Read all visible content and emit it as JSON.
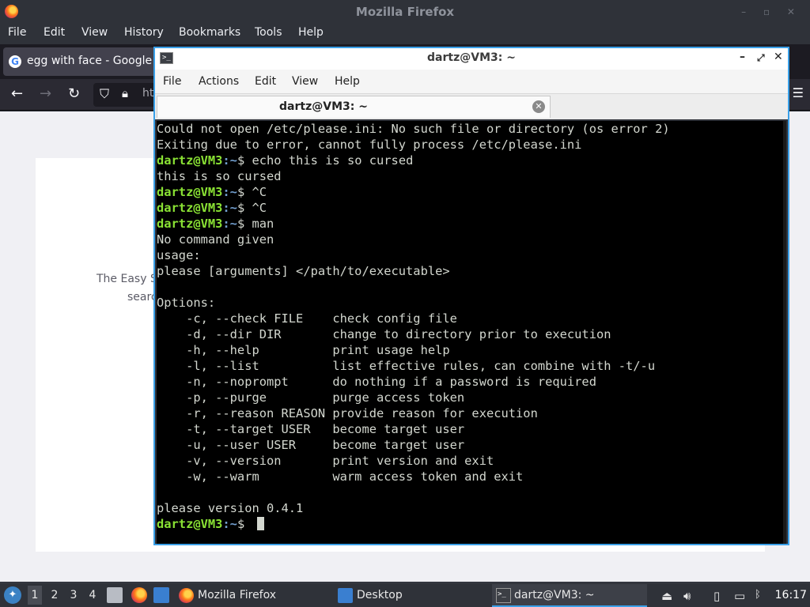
{
  "firefox": {
    "window_title": "Mozilla Firefox",
    "menu": [
      "File",
      "Edit",
      "View",
      "History",
      "Bookmarks",
      "Tools",
      "Help"
    ],
    "tab_title": "egg with face - Google S",
    "url_partial": "ht",
    "page_text_line1": "The Easy S",
    "page_text_line2": "searc"
  },
  "terminal": {
    "window_title": "dartz@VM3: ~",
    "menu": [
      "File",
      "Actions",
      "Edit",
      "View",
      "Help"
    ],
    "tab_title": "dartz@VM3: ~",
    "prompt_user": "dartz@VM3",
    "prompt_path": ":~",
    "prompt_symbol": "$ ",
    "lines": [
      {
        "type": "out",
        "text": "Could not open /etc/please.ini: No such file or directory (os error 2)"
      },
      {
        "type": "out",
        "text": "Exiting due to error, cannot fully process /etc/please.ini"
      },
      {
        "type": "cmd",
        "text": "echo this is so cursed"
      },
      {
        "type": "out",
        "text": "this is so cursed"
      },
      {
        "type": "cmd",
        "text": "^C"
      },
      {
        "type": "cmd",
        "text": "^C"
      },
      {
        "type": "cmd",
        "text": "man"
      },
      {
        "type": "out",
        "text": "No command given"
      },
      {
        "type": "out",
        "text": "usage:"
      },
      {
        "type": "out",
        "text": "please [arguments] </path/to/executable>"
      },
      {
        "type": "out",
        "text": ""
      },
      {
        "type": "out",
        "text": "Options:"
      },
      {
        "type": "out",
        "text": "    -c, --check FILE    check config file"
      },
      {
        "type": "out",
        "text": "    -d, --dir DIR       change to directory prior to execution"
      },
      {
        "type": "out",
        "text": "    -h, --help          print usage help"
      },
      {
        "type": "out",
        "text": "    -l, --list          list effective rules, can combine with -t/-u"
      },
      {
        "type": "out",
        "text": "    -n, --noprompt      do nothing if a password is required"
      },
      {
        "type": "out",
        "text": "    -p, --purge         purge access token"
      },
      {
        "type": "out",
        "text": "    -r, --reason REASON provide reason for execution"
      },
      {
        "type": "out",
        "text": "    -t, --target USER   become target user"
      },
      {
        "type": "out",
        "text": "    -u, --user USER     become target user"
      },
      {
        "type": "out",
        "text": "    -v, --version       print version and exit"
      },
      {
        "type": "out",
        "text": "    -w, --warm          warm access token and exit"
      },
      {
        "type": "out",
        "text": ""
      },
      {
        "type": "out",
        "text": "please version 0.4.1"
      },
      {
        "type": "cursor",
        "text": ""
      }
    ]
  },
  "taskbar": {
    "workspaces": [
      "1",
      "2",
      "3",
      "4"
    ],
    "active_workspace": "1",
    "tasks": [
      "Mozilla Firefox",
      "Desktop",
      "dartz@VM3: ~"
    ],
    "clock": "16:17"
  },
  "colors": {
    "accent": "#3aa0e8",
    "prompt_user": "#8ae234",
    "prompt_path": "#729fcf",
    "terminal_bg": "#000000",
    "terminal_fg": "#d3d7cf"
  }
}
